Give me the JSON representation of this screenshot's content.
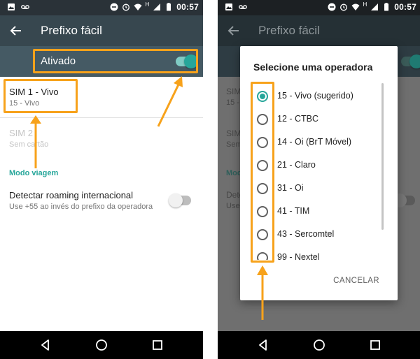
{
  "status_bar": {
    "time": "00:57",
    "network_letter": "H"
  },
  "left_screen": {
    "app_title": "Prefixo fácil",
    "master_switch": {
      "label": "Ativado",
      "state": "on"
    },
    "sim1": {
      "title": "SIM 1 - Vivo",
      "subtitle": "15 - Vivo"
    },
    "sim2": {
      "title": "SIM 2",
      "subtitle": "Sem cartão"
    },
    "category": "Modo viagem",
    "roaming": {
      "title": "Detectar roaming internacional",
      "subtitle": "Use +55 ao invés do prefixo da operadora",
      "state": "off"
    }
  },
  "right_screen": {
    "app_title": "Prefixo fácil",
    "bg_fragments": [
      "SIM",
      "15 -",
      "SIM",
      "Sem",
      "Mod",
      "Detec",
      "Use"
    ],
    "dialog": {
      "title": "Selecione uma operadora",
      "options": [
        {
          "label": "15 - Vivo (sugerido)",
          "selected": true
        },
        {
          "label": "12 - CTBC",
          "selected": false
        },
        {
          "label": "14 - Oi (BrT Móvel)",
          "selected": false
        },
        {
          "label": "21 - Claro",
          "selected": false
        },
        {
          "label": "31 - Oi",
          "selected": false
        },
        {
          "label": "41 - TIM",
          "selected": false
        },
        {
          "label": "43 - Sercomtel",
          "selected": false
        },
        {
          "label": "99 - Nextel",
          "selected": false
        }
      ],
      "cancel_label": "CANCELAR"
    }
  },
  "colors": {
    "accent": "#26a69a",
    "appbar": "#37474f",
    "switchbar": "#455a64",
    "highlight": "#f7a21b"
  },
  "icons": [
    "image-icon",
    "voicemail-icon",
    "dnd-icon",
    "alarm-icon",
    "wifi-icon",
    "signal-icon",
    "battery-icon",
    "back-arrow-icon",
    "nav-back-icon",
    "nav-home-icon",
    "nav-recents-icon"
  ]
}
